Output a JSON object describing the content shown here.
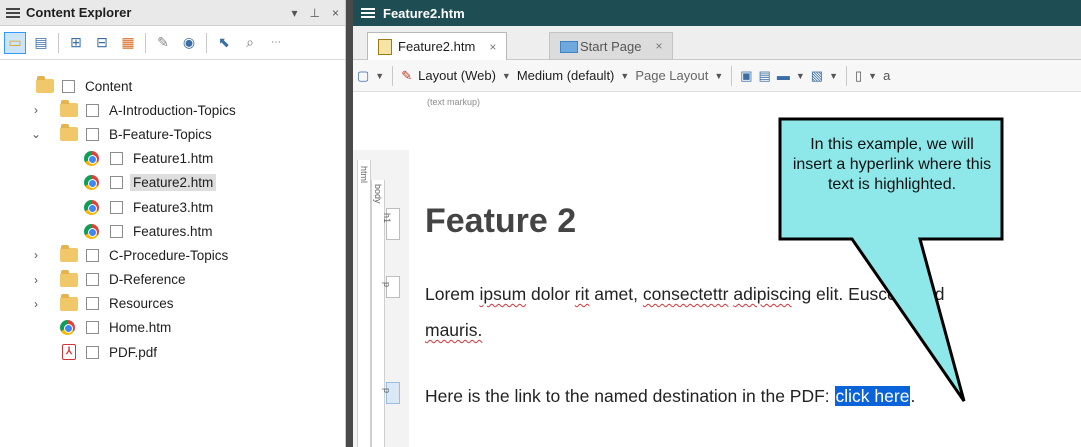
{
  "explorer": {
    "title": "Content Explorer",
    "controls": [
      "▾",
      "ᵖ",
      "×"
    ],
    "tree": [
      {
        "label": "Content",
        "type": "folder-open",
        "level": 0,
        "chevron": ""
      },
      {
        "label": "A-Introduction-Topics",
        "type": "folder",
        "level": 1,
        "chevron": "›"
      },
      {
        "label": "B-Feature-Topics",
        "type": "folder-open",
        "level": 1,
        "chevron": "⌄"
      },
      {
        "label": "Feature1.htm",
        "type": "chrome",
        "level": 2,
        "chevron": ""
      },
      {
        "label": "Feature2.htm",
        "type": "chrome",
        "level": 2,
        "chevron": "",
        "selected": true
      },
      {
        "label": "Feature3.htm",
        "type": "chrome",
        "level": 2,
        "chevron": ""
      },
      {
        "label": "Features.htm",
        "type": "chrome",
        "level": 2,
        "chevron": ""
      },
      {
        "label": "C-Procedure-Topics",
        "type": "folder",
        "level": 1,
        "chevron": "›"
      },
      {
        "label": "D-Reference",
        "type": "folder",
        "level": 1,
        "chevron": "›"
      },
      {
        "label": "Resources",
        "type": "folder",
        "level": 1,
        "chevron": "›"
      },
      {
        "label": "Home.htm",
        "type": "chrome",
        "level": 1,
        "chevron": ""
      },
      {
        "label": "PDF.pdf",
        "type": "pdf",
        "level": 1,
        "chevron": ""
      }
    ]
  },
  "editor": {
    "doc_title": "Feature2.htm",
    "tabs": [
      {
        "label": "Feature2.htm",
        "close": "×"
      },
      {
        "label": "Start Page",
        "close": "×"
      }
    ],
    "toolbar": {
      "layout": "Layout (Web)",
      "medium": "Medium (default)",
      "page_layout": "Page Layout"
    },
    "markup_label": "(text markup)",
    "structure_tags": {
      "html": "html",
      "body": "body",
      "h1": "h1",
      "p": "p"
    },
    "heading": "Feature 2",
    "para1_parts": [
      "Lorem ",
      "ipsum",
      " dolor ",
      "rit",
      " amet, ",
      "consectettr",
      " ",
      "adipisci",
      "ng elit. Eusce bland"
    ],
    "para1_line2": "mauris.",
    "para2_text": "Here is the link to the named destination in the PDF: ",
    "para2_link": "click here",
    "para2_end": "."
  },
  "callout": {
    "text": "In this example, we will insert a hyperlink where this text is highlighted.",
    "fill": "#8ee8ea"
  }
}
